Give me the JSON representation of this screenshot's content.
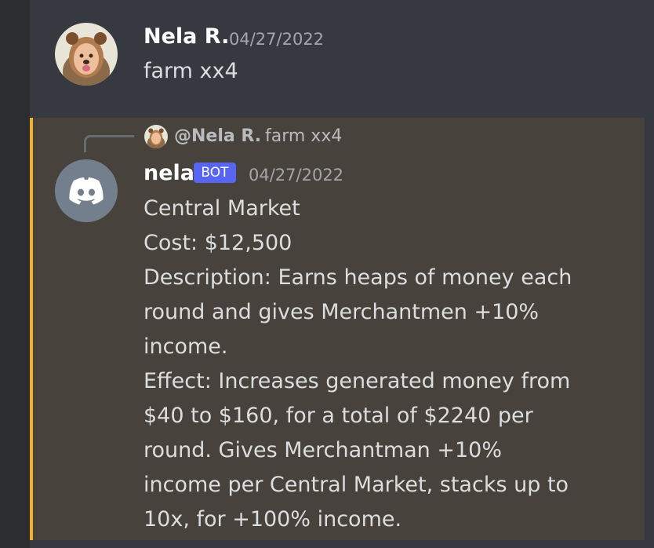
{
  "message_1": {
    "username": "Nela R.",
    "timestamp": "04/27/2022",
    "text": "farm xx4"
  },
  "bot_message": {
    "reply": {
      "mention": "@Nela R.",
      "text": "farm xx4"
    },
    "username": "nela",
    "tag": "BOT",
    "timestamp": "04/27/2022",
    "lines": [
      "Central Market",
      "Cost: $12,500",
      "Description: Earns heaps of money each",
      "round and gives Merchantmen +10%",
      "income.",
      "Effect: Increases generated money from",
      "$40 to $160, for a total of $2240 per",
      "round. Gives Merchantman +10%",
      "income per Central Market, stacks up to",
      "10x, for +100% income."
    ]
  },
  "colors": {
    "background": "#36393f",
    "highlight": "#47423c",
    "highlight_bar": "#f0b132",
    "bot_tag": "#5865f2",
    "bot_avatar": "#747f8d"
  },
  "icons": {
    "user_avatar": "user-avatar-photo",
    "bot_avatar": "discord-logo-icon"
  }
}
